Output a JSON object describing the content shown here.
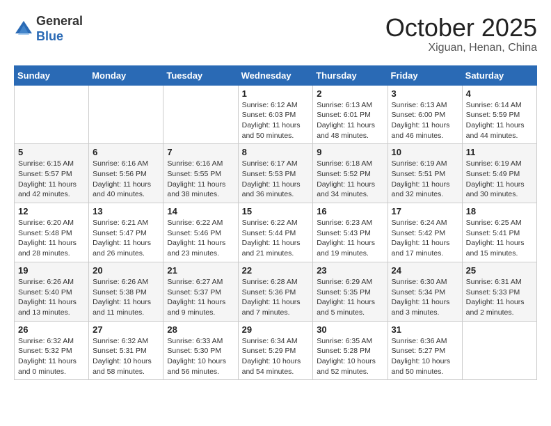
{
  "logo": {
    "general": "General",
    "blue": "Blue"
  },
  "header": {
    "month": "October 2025",
    "location": "Xiguan, Henan, China"
  },
  "weekdays": [
    "Sunday",
    "Monday",
    "Tuesday",
    "Wednesday",
    "Thursday",
    "Friday",
    "Saturday"
  ],
  "weeks": [
    [
      {
        "day": "",
        "info": ""
      },
      {
        "day": "",
        "info": ""
      },
      {
        "day": "",
        "info": ""
      },
      {
        "day": "1",
        "info": "Sunrise: 6:12 AM\nSunset: 6:03 PM\nDaylight: 11 hours\nand 50 minutes."
      },
      {
        "day": "2",
        "info": "Sunrise: 6:13 AM\nSunset: 6:01 PM\nDaylight: 11 hours\nand 48 minutes."
      },
      {
        "day": "3",
        "info": "Sunrise: 6:13 AM\nSunset: 6:00 PM\nDaylight: 11 hours\nand 46 minutes."
      },
      {
        "day": "4",
        "info": "Sunrise: 6:14 AM\nSunset: 5:59 PM\nDaylight: 11 hours\nand 44 minutes."
      }
    ],
    [
      {
        "day": "5",
        "info": "Sunrise: 6:15 AM\nSunset: 5:57 PM\nDaylight: 11 hours\nand 42 minutes."
      },
      {
        "day": "6",
        "info": "Sunrise: 6:16 AM\nSunset: 5:56 PM\nDaylight: 11 hours\nand 40 minutes."
      },
      {
        "day": "7",
        "info": "Sunrise: 6:16 AM\nSunset: 5:55 PM\nDaylight: 11 hours\nand 38 minutes."
      },
      {
        "day": "8",
        "info": "Sunrise: 6:17 AM\nSunset: 5:53 PM\nDaylight: 11 hours\nand 36 minutes."
      },
      {
        "day": "9",
        "info": "Sunrise: 6:18 AM\nSunset: 5:52 PM\nDaylight: 11 hours\nand 34 minutes."
      },
      {
        "day": "10",
        "info": "Sunrise: 6:19 AM\nSunset: 5:51 PM\nDaylight: 11 hours\nand 32 minutes."
      },
      {
        "day": "11",
        "info": "Sunrise: 6:19 AM\nSunset: 5:49 PM\nDaylight: 11 hours\nand 30 minutes."
      }
    ],
    [
      {
        "day": "12",
        "info": "Sunrise: 6:20 AM\nSunset: 5:48 PM\nDaylight: 11 hours\nand 28 minutes."
      },
      {
        "day": "13",
        "info": "Sunrise: 6:21 AM\nSunset: 5:47 PM\nDaylight: 11 hours\nand 26 minutes."
      },
      {
        "day": "14",
        "info": "Sunrise: 6:22 AM\nSunset: 5:46 PM\nDaylight: 11 hours\nand 23 minutes."
      },
      {
        "day": "15",
        "info": "Sunrise: 6:22 AM\nSunset: 5:44 PM\nDaylight: 11 hours\nand 21 minutes."
      },
      {
        "day": "16",
        "info": "Sunrise: 6:23 AM\nSunset: 5:43 PM\nDaylight: 11 hours\nand 19 minutes."
      },
      {
        "day": "17",
        "info": "Sunrise: 6:24 AM\nSunset: 5:42 PM\nDaylight: 11 hours\nand 17 minutes."
      },
      {
        "day": "18",
        "info": "Sunrise: 6:25 AM\nSunset: 5:41 PM\nDaylight: 11 hours\nand 15 minutes."
      }
    ],
    [
      {
        "day": "19",
        "info": "Sunrise: 6:26 AM\nSunset: 5:40 PM\nDaylight: 11 hours\nand 13 minutes."
      },
      {
        "day": "20",
        "info": "Sunrise: 6:26 AM\nSunset: 5:38 PM\nDaylight: 11 hours\nand 11 minutes."
      },
      {
        "day": "21",
        "info": "Sunrise: 6:27 AM\nSunset: 5:37 PM\nDaylight: 11 hours\nand 9 minutes."
      },
      {
        "day": "22",
        "info": "Sunrise: 6:28 AM\nSunset: 5:36 PM\nDaylight: 11 hours\nand 7 minutes."
      },
      {
        "day": "23",
        "info": "Sunrise: 6:29 AM\nSunset: 5:35 PM\nDaylight: 11 hours\nand 5 minutes."
      },
      {
        "day": "24",
        "info": "Sunrise: 6:30 AM\nSunset: 5:34 PM\nDaylight: 11 hours\nand 3 minutes."
      },
      {
        "day": "25",
        "info": "Sunrise: 6:31 AM\nSunset: 5:33 PM\nDaylight: 11 hours\nand 2 minutes."
      }
    ],
    [
      {
        "day": "26",
        "info": "Sunrise: 6:32 AM\nSunset: 5:32 PM\nDaylight: 11 hours\nand 0 minutes."
      },
      {
        "day": "27",
        "info": "Sunrise: 6:32 AM\nSunset: 5:31 PM\nDaylight: 10 hours\nand 58 minutes."
      },
      {
        "day": "28",
        "info": "Sunrise: 6:33 AM\nSunset: 5:30 PM\nDaylight: 10 hours\nand 56 minutes."
      },
      {
        "day": "29",
        "info": "Sunrise: 6:34 AM\nSunset: 5:29 PM\nDaylight: 10 hours\nand 54 minutes."
      },
      {
        "day": "30",
        "info": "Sunrise: 6:35 AM\nSunset: 5:28 PM\nDaylight: 10 hours\nand 52 minutes."
      },
      {
        "day": "31",
        "info": "Sunrise: 6:36 AM\nSunset: 5:27 PM\nDaylight: 10 hours\nand 50 minutes."
      },
      {
        "day": "",
        "info": ""
      }
    ]
  ]
}
